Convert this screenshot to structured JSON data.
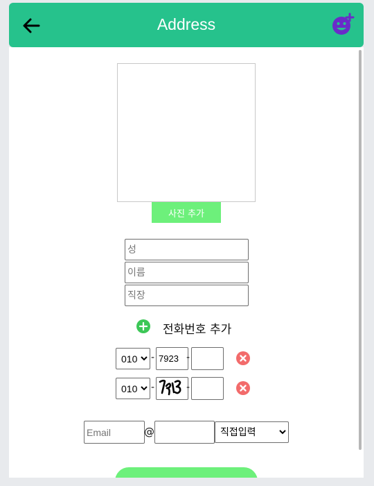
{
  "header": {
    "title": "Address",
    "back_icon": "arrow-left-icon",
    "avatar_icon": "emoji-add-icon"
  },
  "photo": {
    "button_label": "사진 추가"
  },
  "fields": {
    "last_name_placeholder": "성",
    "first_name_placeholder": "이름",
    "company_placeholder": "직장"
  },
  "phone": {
    "add_label": "전화번호 추가",
    "rows": [
      {
        "prefix": "010",
        "middle": "7923",
        "last": "",
        "dash": "-"
      },
      {
        "prefix": "010",
        "middle": "",
        "last": "",
        "dash": "-"
      }
    ]
  },
  "email": {
    "placeholder": "Email",
    "at": "@",
    "domain_value": "",
    "domain_option": "직접입력"
  },
  "colors": {
    "header": "#26c28c",
    "accent": "#6df07b",
    "remove": "#f26b6b",
    "avatar": "#6a2bc9"
  }
}
